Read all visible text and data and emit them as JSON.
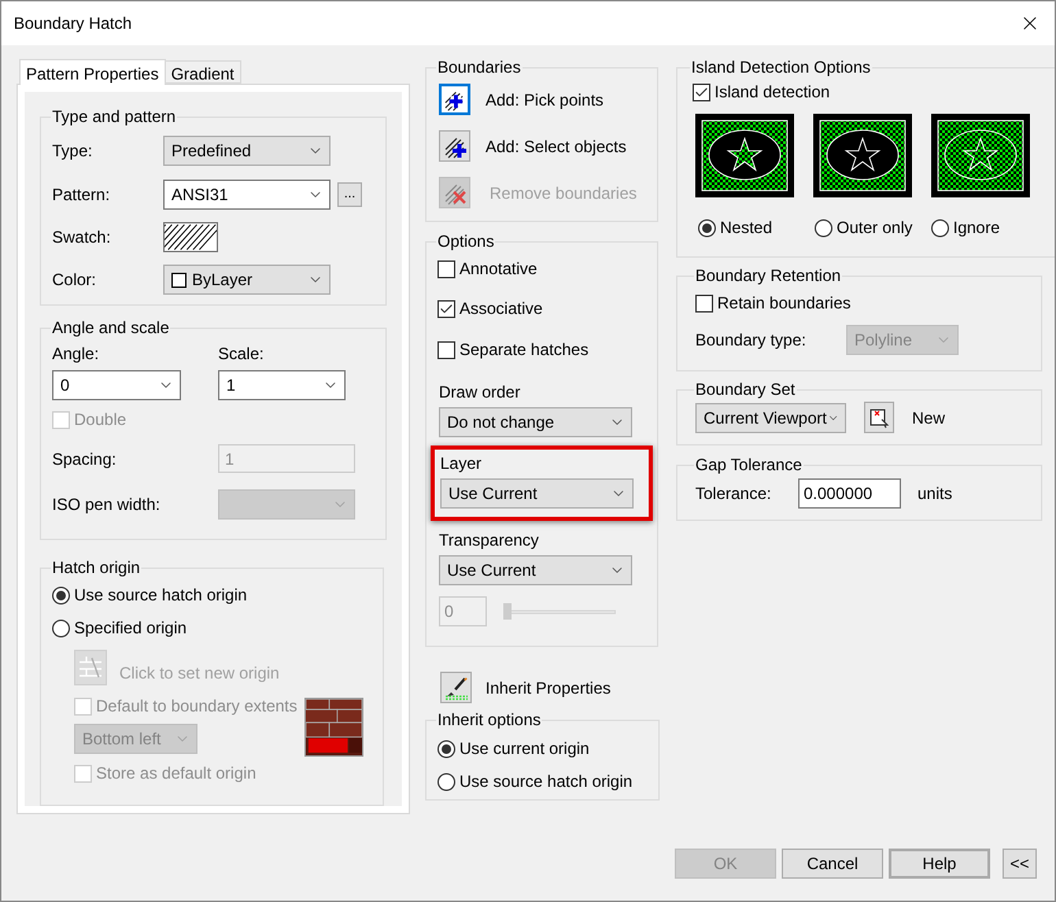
{
  "window": {
    "title": "Boundary Hatch"
  },
  "tabs": [
    {
      "label": "Pattern Properties",
      "selected": true
    },
    {
      "label": "Gradient",
      "selected": false
    }
  ],
  "type_and_pattern": {
    "title": "Type and pattern",
    "type": {
      "label": "Type:",
      "value": "Predefined"
    },
    "pattern": {
      "label": "Pattern:",
      "value": "ANSI31",
      "browse": "..."
    },
    "swatch": {
      "label": "Swatch:"
    },
    "color": {
      "label": "Color:",
      "value": "ByLayer"
    }
  },
  "angle_and_scale": {
    "title": "Angle and scale",
    "angle": {
      "label": "Angle:",
      "value": "0"
    },
    "scale": {
      "label": "Scale:",
      "value": "1"
    },
    "double": {
      "label": "Double",
      "checked": false,
      "disabled": true
    },
    "spacing": {
      "label": "Spacing:",
      "value": "1",
      "disabled": true
    },
    "iso_pen_width": {
      "label": "ISO pen width:",
      "disabled": true
    }
  },
  "hatch_origin": {
    "title": "Hatch origin",
    "options": [
      {
        "label": "Use source hatch origin",
        "selected": true
      },
      {
        "label": "Specified origin",
        "selected": false
      }
    ],
    "click_to_set": {
      "label": "Click to set new origin",
      "disabled": true
    },
    "default_to_extents": {
      "label": "Default to boundary extents",
      "checked": false,
      "disabled": true
    },
    "position": {
      "value": "Bottom left",
      "disabled": true
    },
    "store_default": {
      "label": "Store as default origin",
      "checked": false,
      "disabled": true
    }
  },
  "boundaries": {
    "title": "Boundaries",
    "buttons": [
      {
        "label": "Add: Pick points",
        "kind": "pick",
        "disabled": false,
        "focused": true
      },
      {
        "label": "Add: Select objects",
        "kind": "select",
        "disabled": false,
        "focused": false
      },
      {
        "label": "Remove boundaries",
        "kind": "remove",
        "disabled": true,
        "focused": false
      }
    ]
  },
  "options": {
    "title": "Options",
    "checks": [
      {
        "label": "Annotative",
        "checked": false
      },
      {
        "label": "Associative",
        "checked": true
      },
      {
        "label": "Separate hatches",
        "checked": false
      }
    ],
    "draw_order": {
      "label": "Draw order",
      "value": "Do not change"
    },
    "layer": {
      "label": "Layer",
      "value": "Use Current",
      "highlighted": true
    },
    "transparency": {
      "label": "Transparency",
      "value": "Use Current",
      "amount": "0",
      "level": 0,
      "disabled": true
    }
  },
  "inherit_properties": {
    "label": "Inherit Properties"
  },
  "inherit_options": {
    "title": "Inherit options",
    "options": [
      {
        "label": "Use current origin",
        "selected": true
      },
      {
        "label": "Use source hatch origin",
        "selected": false
      }
    ]
  },
  "island_detection": {
    "title": "Island Detection Options",
    "enabled": {
      "label": "Island detection",
      "checked": true
    },
    "modes": [
      {
        "label": "Nested",
        "kind": "nested",
        "selected": true
      },
      {
        "label": "Outer only",
        "kind": "outer",
        "selected": false
      },
      {
        "label": "Ignore",
        "kind": "ignore",
        "selected": false
      }
    ]
  },
  "boundary_retention": {
    "title": "Boundary Retention",
    "retain": {
      "label": "Retain boundaries",
      "checked": false
    },
    "type": {
      "label": "Boundary type:",
      "value": "Polyline",
      "disabled": true
    }
  },
  "boundary_set": {
    "title": "Boundary Set",
    "value": "Current Viewport",
    "new": "New"
  },
  "gap_tolerance": {
    "title": "Gap Tolerance",
    "label": "Tolerance:",
    "value": "0.000000",
    "units": "units"
  },
  "buttons": [
    {
      "label": "OK",
      "disabled": true,
      "default": false
    },
    {
      "label": "Cancel",
      "disabled": false,
      "default": false
    },
    {
      "label": "Help",
      "disabled": false,
      "default": true
    },
    {
      "label": "<<",
      "disabled": false,
      "default": false
    }
  ]
}
